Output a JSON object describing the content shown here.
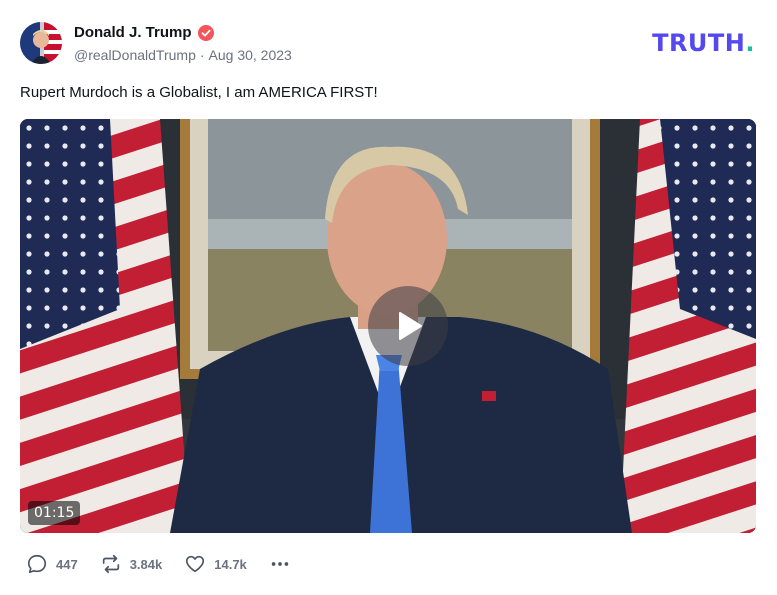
{
  "author": {
    "display_name": "Donald J. Trump",
    "handle": "@realDonaldTrump",
    "separator": "·",
    "date": "Aug 30, 2023",
    "avatar_icon": "avatar-icon",
    "verified_icon": "verified-badge-icon",
    "verified_color": "#f2555a"
  },
  "brand": {
    "name": "TRUTH",
    "dot": ".",
    "color": "#5448ee",
    "dot_color": "#10c39e"
  },
  "post": {
    "text": "Rupert Murdoch is a Globalist, I am AMERICA FIRST!"
  },
  "video": {
    "duration": "01:15",
    "play_icon": "play-icon"
  },
  "actions": {
    "replies": {
      "count": "447",
      "icon": "reply-icon"
    },
    "retruths": {
      "count": "3.84k",
      "icon": "retruth-icon"
    },
    "likes": {
      "count": "14.7k",
      "icon": "heart-icon"
    },
    "more_icon": "more-icon"
  }
}
